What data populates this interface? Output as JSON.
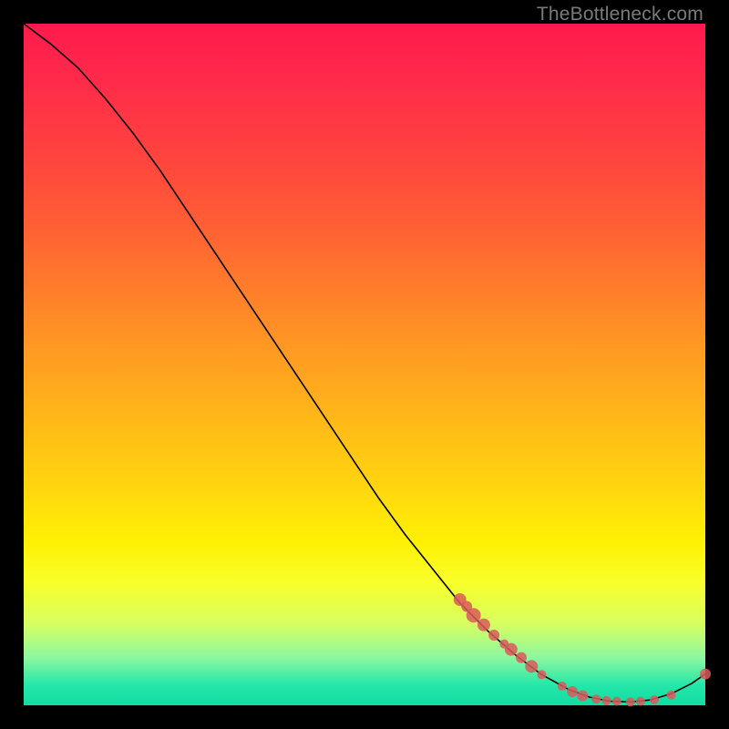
{
  "watermark": "TheBottleneck.com",
  "colors": {
    "marker": "#d95b5b",
    "curve": "#000000",
    "frame_bg": "#000000"
  },
  "chart_data": {
    "type": "line",
    "title": "",
    "xlabel": "",
    "ylabel": "",
    "xlim": [
      0,
      100
    ],
    "ylim": [
      0,
      100
    ],
    "grid": false,
    "legend": false,
    "series": [
      {
        "name": "curve",
        "kind": "line",
        "x": [
          0,
          4,
          8,
          12,
          16,
          20,
          24,
          28,
          32,
          36,
          40,
          44,
          48,
          52,
          56,
          60,
          64,
          68,
          72,
          76,
          80,
          83,
          86,
          89,
          92,
          95,
          98,
          100
        ],
        "y": [
          100,
          97,
          93.5,
          89,
          84,
          78.5,
          72.5,
          66.5,
          60.5,
          54.5,
          48.5,
          42.5,
          36.5,
          30.5,
          25,
          20,
          15,
          11,
          7.5,
          4.5,
          2.3,
          1.2,
          0.6,
          0.5,
          0.8,
          1.7,
          3.2,
          4.6
        ]
      },
      {
        "name": "markers",
        "kind": "scatter",
        "points": [
          {
            "x": 64,
            "y": 15.5,
            "r": 7
          },
          {
            "x": 65,
            "y": 14.5,
            "r": 6
          },
          {
            "x": 66,
            "y": 13.2,
            "r": 8
          },
          {
            "x": 67.5,
            "y": 11.8,
            "r": 7
          },
          {
            "x": 69,
            "y": 10.3,
            "r": 6
          },
          {
            "x": 70.5,
            "y": 9.0,
            "r": 5
          },
          {
            "x": 71.5,
            "y": 8.2,
            "r": 7
          },
          {
            "x": 73,
            "y": 7.0,
            "r": 6
          },
          {
            "x": 74.5,
            "y": 5.7,
            "r": 7
          },
          {
            "x": 76,
            "y": 4.5,
            "r": 5
          },
          {
            "x": 79,
            "y": 2.8,
            "r": 5
          },
          {
            "x": 80.5,
            "y": 2.0,
            "r": 6
          },
          {
            "x": 82,
            "y": 1.4,
            "r": 6
          },
          {
            "x": 84,
            "y": 0.9,
            "r": 5
          },
          {
            "x": 85.5,
            "y": 0.7,
            "r": 5
          },
          {
            "x": 87,
            "y": 0.6,
            "r": 5
          },
          {
            "x": 89,
            "y": 0.5,
            "r": 5
          },
          {
            "x": 90.5,
            "y": 0.6,
            "r": 5
          },
          {
            "x": 92.5,
            "y": 0.8,
            "r": 5
          },
          {
            "x": 95,
            "y": 1.5,
            "r": 5
          },
          {
            "x": 100,
            "y": 4.6,
            "r": 6
          }
        ]
      }
    ]
  }
}
